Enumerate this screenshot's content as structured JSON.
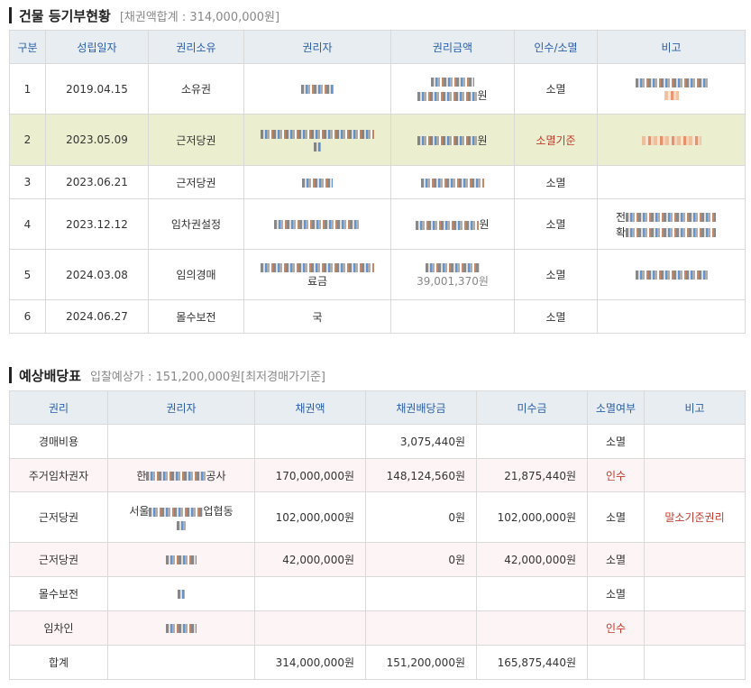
{
  "registry": {
    "title": "건물 등기부현황",
    "summary": "[채권액합계 : 314,000,000원]",
    "headers": [
      "구분",
      "성립일자",
      "권리소유",
      "권리자",
      "권리금액",
      "인수/소멸",
      "비고"
    ],
    "rows": [
      {
        "no": "1",
        "date": "2019.04.15",
        "type": "소유권",
        "holder": "",
        "amount": "원",
        "status": "소멸",
        "note": ""
      },
      {
        "no": "2",
        "date": "2023.05.09",
        "type": "근저당권",
        "holder": "",
        "amount": "원",
        "status": "소멸기준",
        "note": ""
      },
      {
        "no": "3",
        "date": "2023.06.21",
        "type": "근저당권",
        "holder": "",
        "amount": "",
        "status": "소멸",
        "note": ""
      },
      {
        "no": "4",
        "date": "2023.12.12",
        "type": "임차권설정",
        "holder": "",
        "amount": "원",
        "status": "소멸",
        "note": ""
      },
      {
        "no": "5",
        "date": "2024.03.08",
        "type": "임의경매",
        "holder": "",
        "amount": "원",
        "status": "소멸",
        "note": ""
      },
      {
        "no": "6",
        "date": "2024.06.27",
        "type": "몰수보전",
        "holder": "국",
        "amount": "",
        "status": "소멸",
        "note": ""
      }
    ],
    "partial": {
      "row4_note_a": "전",
      "row4_note_b": "확",
      "row5_holder_suffix": "료금",
      "row5_amount_partial": "39,001,370원"
    }
  },
  "distribution": {
    "title": "예상배당표",
    "summary": "입찰예상가 : 151,200,000원[최저경매가기준]",
    "headers": [
      "권리",
      "권리자",
      "채권액",
      "채권배당금",
      "미수금",
      "소멸여부",
      "비고"
    ],
    "rows": [
      {
        "right": "경매비용",
        "holder": "",
        "claim": "",
        "dividend": "3,075,440원",
        "unpaid": "",
        "status": "소멸",
        "note": ""
      },
      {
        "right": "주거임차권자",
        "holder": "한",
        "holder_suffix": "공사",
        "claim": "170,000,000원",
        "dividend": "148,124,560원",
        "unpaid": "21,875,440원",
        "status": "인수",
        "note": ""
      },
      {
        "right": "근저당권",
        "holder": "서울",
        "holder_suffix": "업협동",
        "claim": "102,000,000원",
        "dividend": "0원",
        "unpaid": "102,000,000원",
        "status": "소멸",
        "note": "말소기준권리"
      },
      {
        "right": "근저당권",
        "holder": "",
        "claim": "42,000,000원",
        "dividend": "0원",
        "unpaid": "42,000,000원",
        "status": "소멸",
        "note": ""
      },
      {
        "right": "몰수보전",
        "holder": "",
        "claim": "",
        "dividend": "",
        "unpaid": "",
        "status": "소멸",
        "note": ""
      },
      {
        "right": "임차인",
        "holder": "",
        "claim": "",
        "dividend": "",
        "unpaid": "",
        "status": "인수",
        "note": ""
      },
      {
        "right": "합계",
        "holder": "",
        "claim": "314,000,000원",
        "dividend": "151,200,000원",
        "unpaid": "165,875,440원",
        "status": "",
        "note": ""
      }
    ]
  }
}
